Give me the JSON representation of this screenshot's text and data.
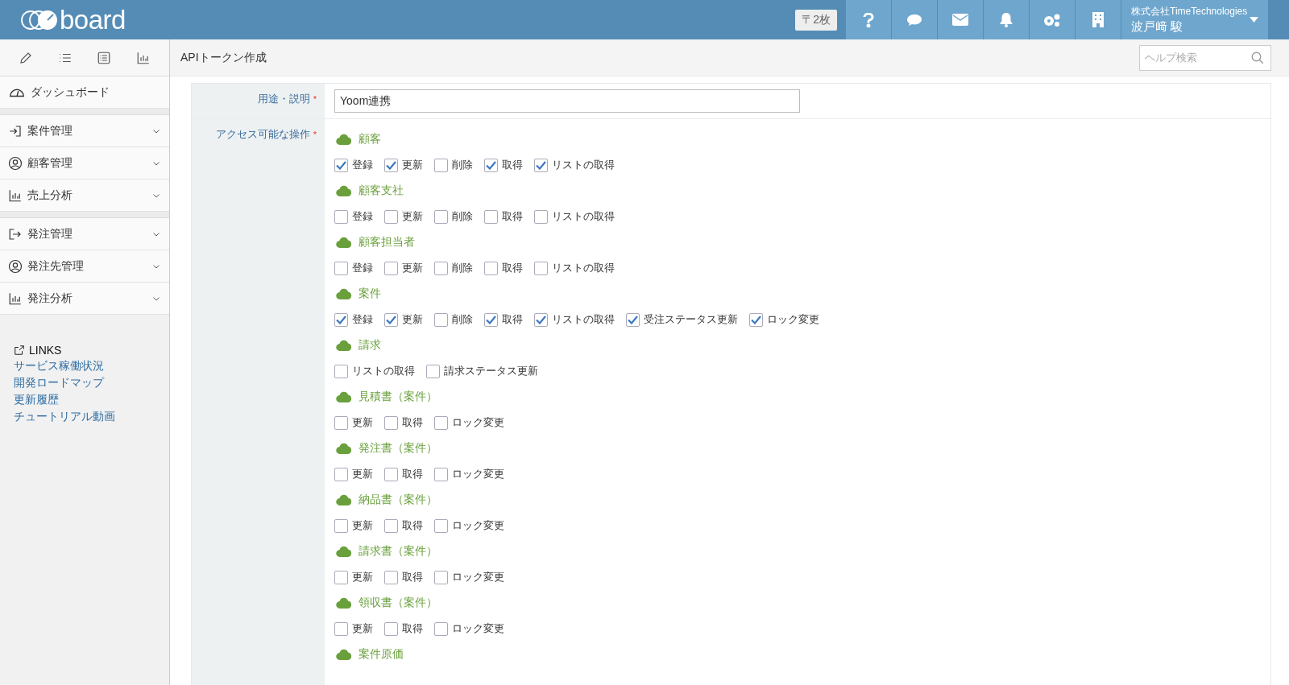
{
  "header": {
    "logo": "board",
    "badge": "〒2枚",
    "company": "株式会社TimeTechnologies",
    "user": "波戸﨑 駿"
  },
  "sidebar": {
    "dashboard": "ダッシュボード",
    "groups": [
      [
        {
          "label": "案件管理",
          "kind": "enter"
        },
        {
          "label": "顧客管理",
          "kind": "person"
        },
        {
          "label": "売上分析",
          "kind": "chart"
        }
      ],
      [
        {
          "label": "発注管理",
          "kind": "exit"
        },
        {
          "label": "発注先管理",
          "kind": "person"
        },
        {
          "label": "発注分析",
          "kind": "chart"
        }
      ]
    ],
    "links_title": "LINKS",
    "links": [
      "サービス稼働状況",
      "開発ロードマップ",
      "更新履歴",
      "チュートリアル動画"
    ]
  },
  "page": {
    "title": "APIトークン作成",
    "help_search": {
      "placeholder": "ヘルプ検索"
    }
  },
  "form": {
    "purpose": {
      "label": "用途・説明",
      "required": "*",
      "value": "Yoom連携"
    },
    "access": {
      "label": "アクセス可能な操作",
      "required": "*",
      "groups": [
        {
          "name": "顧客",
          "options": [
            {
              "label": "登録",
              "checked": true
            },
            {
              "label": "更新",
              "checked": true
            },
            {
              "label": "削除",
              "checked": false
            },
            {
              "label": "取得",
              "checked": true
            },
            {
              "label": "リストの取得",
              "checked": true
            }
          ]
        },
        {
          "name": "顧客支社",
          "options": [
            {
              "label": "登録",
              "checked": false
            },
            {
              "label": "更新",
              "checked": false
            },
            {
              "label": "削除",
              "checked": false
            },
            {
              "label": "取得",
              "checked": false
            },
            {
              "label": "リストの取得",
              "checked": false
            }
          ]
        },
        {
          "name": "顧客担当者",
          "options": [
            {
              "label": "登録",
              "checked": false
            },
            {
              "label": "更新",
              "checked": false
            },
            {
              "label": "削除",
              "checked": false
            },
            {
              "label": "取得",
              "checked": false
            },
            {
              "label": "リストの取得",
              "checked": false
            }
          ]
        },
        {
          "name": "案件",
          "options": [
            {
              "label": "登録",
              "checked": true
            },
            {
              "label": "更新",
              "checked": true
            },
            {
              "label": "削除",
              "checked": false
            },
            {
              "label": "取得",
              "checked": true
            },
            {
              "label": "リストの取得",
              "checked": true
            },
            {
              "label": "受注ステータス更新",
              "checked": true
            },
            {
              "label": "ロック変更",
              "checked": true
            }
          ]
        },
        {
          "name": "請求",
          "options": [
            {
              "label": "リストの取得",
              "checked": false
            },
            {
              "label": "請求ステータス更新",
              "checked": false
            }
          ]
        },
        {
          "name": "見積書（案件）",
          "options": [
            {
              "label": "更新",
              "checked": false
            },
            {
              "label": "取得",
              "checked": false
            },
            {
              "label": "ロック変更",
              "checked": false
            }
          ]
        },
        {
          "name": "発注書（案件）",
          "options": [
            {
              "label": "更新",
              "checked": false
            },
            {
              "label": "取得",
              "checked": false
            },
            {
              "label": "ロック変更",
              "checked": false
            }
          ]
        },
        {
          "name": "納品書（案件）",
          "options": [
            {
              "label": "更新",
              "checked": false
            },
            {
              "label": "取得",
              "checked": false
            },
            {
              "label": "ロック変更",
              "checked": false
            }
          ]
        },
        {
          "name": "請求書（案件）",
          "options": [
            {
              "label": "更新",
              "checked": false
            },
            {
              "label": "取得",
              "checked": false
            },
            {
              "label": "ロック変更",
              "checked": false
            }
          ]
        },
        {
          "name": "領収書（案件）",
          "options": [
            {
              "label": "更新",
              "checked": false
            },
            {
              "label": "取得",
              "checked": false
            },
            {
              "label": "ロック変更",
              "checked": false
            }
          ]
        },
        {
          "name": "案件原価"
        }
      ]
    }
  }
}
